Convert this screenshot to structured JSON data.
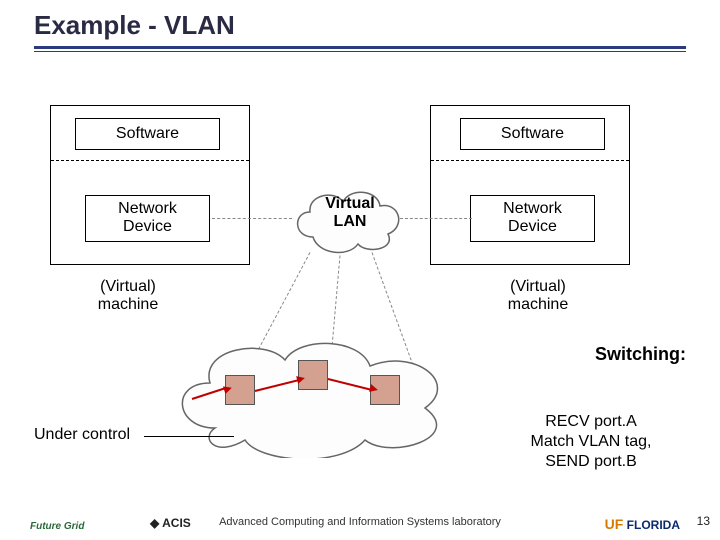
{
  "title": "Example - VLAN",
  "left_machine": {
    "software_label": "Software",
    "network_device_label": "Network\nDevice",
    "caption": "(Virtual)\nmachine"
  },
  "right_machine": {
    "software_label": "Software",
    "network_device_label": "Network\nDevice",
    "caption": "(Virtual)\nmachine"
  },
  "vlan_cloud_label": "Virtual\nLAN",
  "switching": {
    "heading": "Switching:",
    "body": "RECV port.A\nMatch VLAN tag,\nSEND port.B"
  },
  "under_control_label": "Under control",
  "footer": "Advanced Computing and Information Systems laboratory",
  "page_number": "13",
  "logos": {
    "future_grid": "Future Grid",
    "acis": "ACIS",
    "uf": "UF",
    "uf_name": "FLORIDA"
  }
}
